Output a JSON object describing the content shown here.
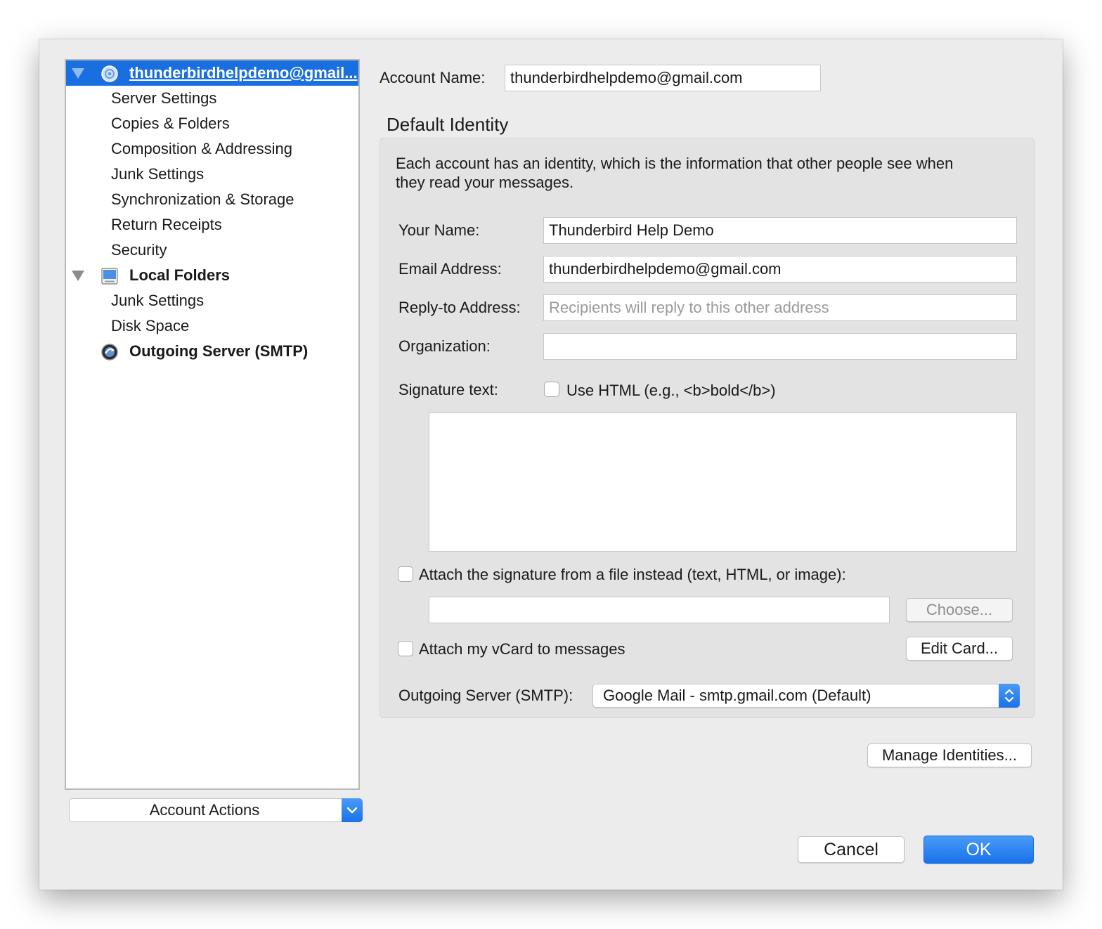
{
  "sidebar": {
    "account_email": "thunderbirdhelpdemo@gmail...",
    "account_items": [
      "Server Settings",
      "Copies & Folders",
      "Composition & Addressing",
      "Junk Settings",
      "Synchronization & Storage",
      "Return Receipts",
      "Security"
    ],
    "local_folders": "Local Folders",
    "local_items": [
      "Junk Settings",
      "Disk Space"
    ],
    "outgoing_server": "Outgoing Server (SMTP)",
    "account_actions": "Account Actions"
  },
  "main": {
    "account_name_label": "Account Name:",
    "account_name_value": "thunderbirdhelpdemo@gmail.com",
    "identity_heading": "Default Identity",
    "identity_description_line1": "Each account has an identity, which is the information that other people see when",
    "identity_description_line2": "they read your messages.",
    "your_name_label": "Your Name:",
    "your_name_value": "Thunderbird Help Demo",
    "email_label": "Email Address:",
    "email_value": "thunderbirdhelpdemo@gmail.com",
    "reply_to_label": "Reply-to Address:",
    "reply_to_placeholder": "Recipients will reply to this other address",
    "organization_label": "Organization:",
    "organization_value": "",
    "signature_label": "Signature text:",
    "use_html_label": "Use HTML (e.g., <b>bold</b>)",
    "signature_value": "",
    "attach_sig_label": "Attach the signature from a file instead (text, HTML, or image):",
    "sig_file_value": "",
    "choose_button": "Choose...",
    "vcard_label": "Attach my vCard to messages",
    "edit_card_button": "Edit Card...",
    "smtp_label": "Outgoing Server (SMTP):",
    "smtp_value": "Google Mail - smtp.gmail.com (Default)",
    "manage_identities_button": "Manage Identities...",
    "cancel_button": "Cancel",
    "ok_button": "OK"
  },
  "colors": {
    "selection": "#1a6fe0",
    "primary_button": "#1872ea",
    "window_bg": "#ececec"
  },
  "icons": {
    "account": "at-icon",
    "local_folders": "computer-icon",
    "outgoing_server": "globe-icon",
    "twisty": "triangle-down-icon",
    "dropdown": "chevron-down-icon",
    "stepper": "chevron-updown-icon"
  }
}
